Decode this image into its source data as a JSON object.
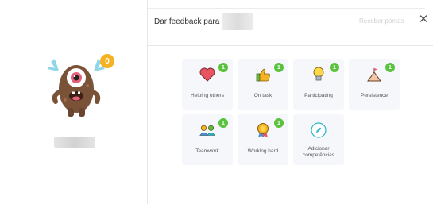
{
  "student": {
    "points": "0"
  },
  "header": {
    "title": "Dar feedback para",
    "receive_points": "Receber pontos",
    "close_symbol": "✕"
  },
  "skills": [
    {
      "label": "Helping others",
      "count": "1",
      "icon": "heart-icon"
    },
    {
      "label": "On task",
      "count": "1",
      "icon": "thumbs-up-icon"
    },
    {
      "label": "Participating",
      "count": "1",
      "icon": "lightbulb-icon"
    },
    {
      "label": "Persistence",
      "count": "1",
      "icon": "mountain-flag-icon"
    },
    {
      "label": "Teamwork",
      "count": "1",
      "icon": "people-icon"
    },
    {
      "label": "Working hard",
      "count": "1",
      "icon": "medal-icon"
    }
  ],
  "add_skills": {
    "label": "Adicionar competências",
    "icon": "pencil-icon"
  },
  "colors": {
    "badge_orange": "#f5b324",
    "count_green": "#5bc23f",
    "card_bg": "#f6f7fa",
    "accent_teal": "#2bb5c8"
  }
}
